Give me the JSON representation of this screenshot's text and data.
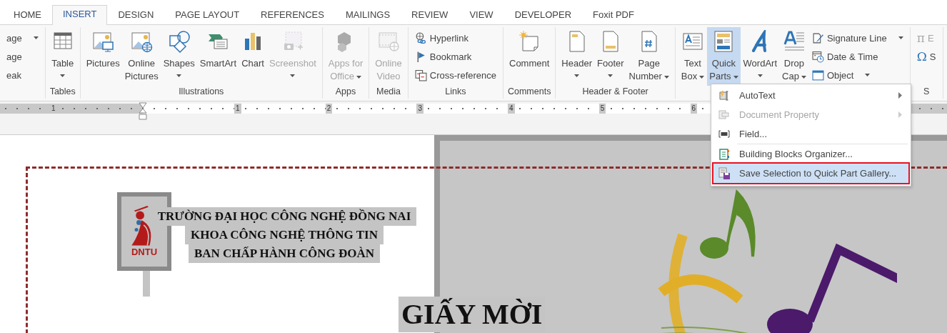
{
  "tabs": [
    {
      "label": "HOME",
      "selected": false
    },
    {
      "label": "INSERT",
      "selected": true
    },
    {
      "label": "DESIGN",
      "selected": false
    },
    {
      "label": "PAGE LAYOUT",
      "selected": false
    },
    {
      "label": "REFERENCES",
      "selected": false
    },
    {
      "label": "MAILINGS",
      "selected": false
    },
    {
      "label": "REVIEW",
      "selected": false
    },
    {
      "label": "VIEW",
      "selected": false
    },
    {
      "label": "DEVELOPER",
      "selected": false
    },
    {
      "label": "Foxit PDF",
      "selected": false
    }
  ],
  "ribbon": {
    "groups": [
      {
        "items": [
          {
            "kind": "stack",
            "buttons": [
              {
                "label": "age",
                "dropdown": true,
                "disabled": false
              },
              {
                "label": "age",
                "dropdown": false,
                "disabled": false
              },
              {
                "label": "eak",
                "dropdown": false,
                "disabled": false
              }
            ]
          }
        ]
      },
      {
        "label": "Tables",
        "items": [
          {
            "kind": "large",
            "label": "Table",
            "dropdown": true,
            "disabled": false,
            "pressed": false
          }
        ]
      },
      {
        "label": "Illustrations",
        "items": [
          {
            "kind": "large",
            "label": "Pictures",
            "dropdown": false,
            "disabled": false,
            "pressed": false
          },
          {
            "kind": "large",
            "label": "Online\nPictures",
            "dropdown": false,
            "disabled": false,
            "pressed": false
          },
          {
            "kind": "large",
            "label": "Shapes",
            "dropdown": true,
            "disabled": false,
            "pressed": false
          },
          {
            "kind": "large",
            "label": "SmartArt",
            "dropdown": false,
            "disabled": false,
            "pressed": false
          },
          {
            "kind": "large",
            "label": "Chart",
            "dropdown": false,
            "disabled": false,
            "pressed": false
          },
          {
            "kind": "large",
            "label": "Screenshot",
            "dropdown": true,
            "disabled": true,
            "pressed": false
          }
        ]
      },
      {
        "label": "Apps",
        "items": [
          {
            "kind": "large",
            "label": "Apps for\nOffice",
            "dropdown": true,
            "disabled": true,
            "pressed": false
          }
        ]
      },
      {
        "label": "Media",
        "items": [
          {
            "kind": "large",
            "label": "Online\nVideo",
            "dropdown": false,
            "disabled": true,
            "pressed": false
          }
        ]
      },
      {
        "label": "Links",
        "items": [
          {
            "kind": "stack",
            "buttons": [
              {
                "label": "Hyperlink",
                "dropdown": false,
                "disabled": false
              },
              {
                "label": "Bookmark",
                "dropdown": false,
                "disabled": false
              },
              {
                "label": "Cross-reference",
                "dropdown": false,
                "disabled": false
              }
            ]
          }
        ]
      },
      {
        "label": "Comments",
        "items": [
          {
            "kind": "large",
            "label": "Comment",
            "dropdown": false,
            "disabled": false,
            "pressed": false
          }
        ]
      },
      {
        "label": "Header & Footer",
        "items": [
          {
            "kind": "large",
            "label": "Header",
            "dropdown": true,
            "disabled": false,
            "pressed": false
          },
          {
            "kind": "large",
            "label": "Footer",
            "dropdown": true,
            "disabled": false,
            "pressed": false
          },
          {
            "kind": "large",
            "label": "Page\nNumber",
            "dropdown": true,
            "disabled": false,
            "pressed": false
          }
        ]
      },
      {
        "items": [
          {
            "kind": "large",
            "label": "Text\nBox",
            "dropdown": true,
            "disabled": false,
            "pressed": false
          },
          {
            "kind": "large",
            "label": "Quick\nParts",
            "dropdown": true,
            "disabled": false,
            "pressed": true
          },
          {
            "kind": "large",
            "label": "WordArt",
            "dropdown": true,
            "disabled": false,
            "pressed": false
          },
          {
            "kind": "large",
            "label": "Drop\nCap",
            "dropdown": true,
            "disabled": false,
            "pressed": false
          },
          {
            "kind": "stack",
            "buttons": [
              {
                "label": "Signature Line",
                "dropdown": true,
                "disabled": false
              },
              {
                "label": "Date & Time",
                "dropdown": false,
                "disabled": false
              },
              {
                "label": "Object",
                "dropdown": true,
                "disabled": false
              }
            ]
          }
        ]
      },
      {
        "label": "S",
        "items": [
          {
            "kind": "stack",
            "buttons": [
              {
                "glyph": "π",
                "label": "E",
                "dropdown": false,
                "disabled": true
              },
              {
                "glyph": "Ω",
                "label": "S",
                "dropdown": false,
                "disabled": false
              }
            ]
          }
        ]
      }
    ]
  },
  "ruler": {
    "numbers": [
      "1",
      "1",
      "2",
      "3",
      "4",
      "5",
      "6"
    ]
  },
  "quick_parts_menu": {
    "items": [
      {
        "label": "AutoText",
        "disabled": false,
        "submenu": true,
        "selected": false,
        "annotated": false,
        "divider_after": false
      },
      {
        "label": "Document Property",
        "disabled": true,
        "submenu": true,
        "selected": false,
        "annotated": false,
        "divider_after": false
      },
      {
        "label": "Field...",
        "disabled": false,
        "submenu": false,
        "selected": false,
        "annotated": false,
        "divider_after": true
      },
      {
        "label": "Building Blocks Organizer...",
        "disabled": false,
        "submenu": false,
        "selected": false,
        "annotated": false,
        "divider_after": false
      },
      {
        "label": "Save Selection to Quick Part Gallery...",
        "disabled": false,
        "submenu": false,
        "selected": true,
        "annotated": true,
        "divider_after": false
      }
    ]
  },
  "document": {
    "logo_text": "DNTU",
    "header_lines": [
      "TRƯỜNG ĐẠI HỌC CÔNG NGHỆ ĐỒNG NAI",
      "KHOA CÔNG NGHỆ THÔNG TIN",
      "BAN CHẤP HÀNH CÔNG ĐOÀN"
    ],
    "title": "GIẤY MỜI"
  }
}
